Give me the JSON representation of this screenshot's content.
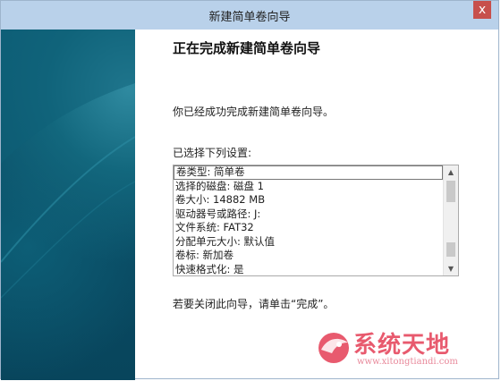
{
  "window": {
    "title": "新建简单卷向导",
    "close_glyph": "x"
  },
  "content": {
    "heading": "正在完成新建简单卷向导",
    "success_text": "你已经成功完成新建简单卷向导。",
    "settings_label": "已选择下列设置:",
    "settings": [
      "卷类型: 简单卷",
      "选择的磁盘: 磁盘 1",
      "卷大小: 14882 MB",
      "驱动器号或路径: J:",
      "文件系统: FAT32",
      "分配单元大小: 默认值",
      "卷标: 新加卷",
      "快速格式化: 是"
    ],
    "selected_index": 0,
    "close_hint": "若要关闭此向导，请单击“完成”。"
  },
  "watermark": {
    "brand": "系统天地",
    "url": "www.xitongtiandi.com"
  },
  "colors": {
    "titlebar": "#b9d1ea",
    "sidebar": "#0a4b64",
    "close_button": "#c7504c",
    "watermark": "#e85a6e"
  }
}
